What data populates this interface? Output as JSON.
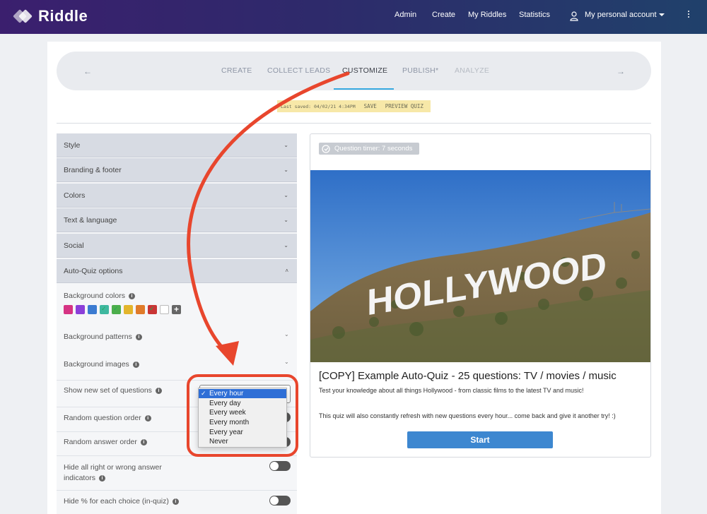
{
  "brand": {
    "name": "Riddle"
  },
  "nav": {
    "links": [
      "Admin",
      "Create",
      "My Riddles",
      "Statistics"
    ],
    "account": "My personal account"
  },
  "steps": {
    "prev_icon": "arrow-left-icon",
    "next_icon": "arrow-right-icon",
    "items": [
      "CREATE",
      "COLLECT LEADS",
      "CUSTOMIZE",
      "PUBLISH*",
      "ANALYZE"
    ],
    "active": "CUSTOMIZE"
  },
  "saved_bar": {
    "last_saved": "Last saved: 04/02/21 4:34PM",
    "save": "SAVE",
    "preview": "PREVIEW QUIZ"
  },
  "panel": {
    "sections": [
      "Style",
      "Branding & footer",
      "Colors",
      "Text & language",
      "Social",
      "Auto-Quiz options"
    ],
    "background_colors_label": "Background colors",
    "swatch_colors": [
      "#d63384",
      "#8b3fd9",
      "#3b7bd1",
      "#3fb8a0",
      "#4cae4c",
      "#e3b52c",
      "#e07b2a",
      "#c93535",
      "#ffffff"
    ],
    "background_patterns_label": "Background patterns",
    "background_images_label": "Background images",
    "show_new_set_label": "Show new set of questions",
    "random_question_label": "Random question order",
    "random_answer_label": "Random answer order",
    "hide_indicators_label_1": "Hide all right or wrong answer",
    "hide_indicators_label_2": "indicators",
    "hide_percent_label": "Hide % for each choice (in-quiz)"
  },
  "dropdown": {
    "options": [
      "Every hour",
      "Every day",
      "Every week",
      "Every month",
      "Every year",
      "Never"
    ],
    "selected": "Every hour"
  },
  "preview": {
    "timer": "Question timer: 7 seconds",
    "hero_sign": "HOLLYWOOD",
    "title": "[COPY] Example Auto-Quiz - 25 questions: TV / movies / music",
    "description": "Test your knowledge about all things Hollywood - from classic films to the latest TV and music!",
    "refresh_note": "This quiz will also constantly refresh with new questions every hour... come back and give it another try! :)",
    "start": "Start"
  },
  "colors": {
    "accent": "#37a9e0",
    "annotation_red": "#e8462d",
    "start_button": "#3d87d0"
  }
}
